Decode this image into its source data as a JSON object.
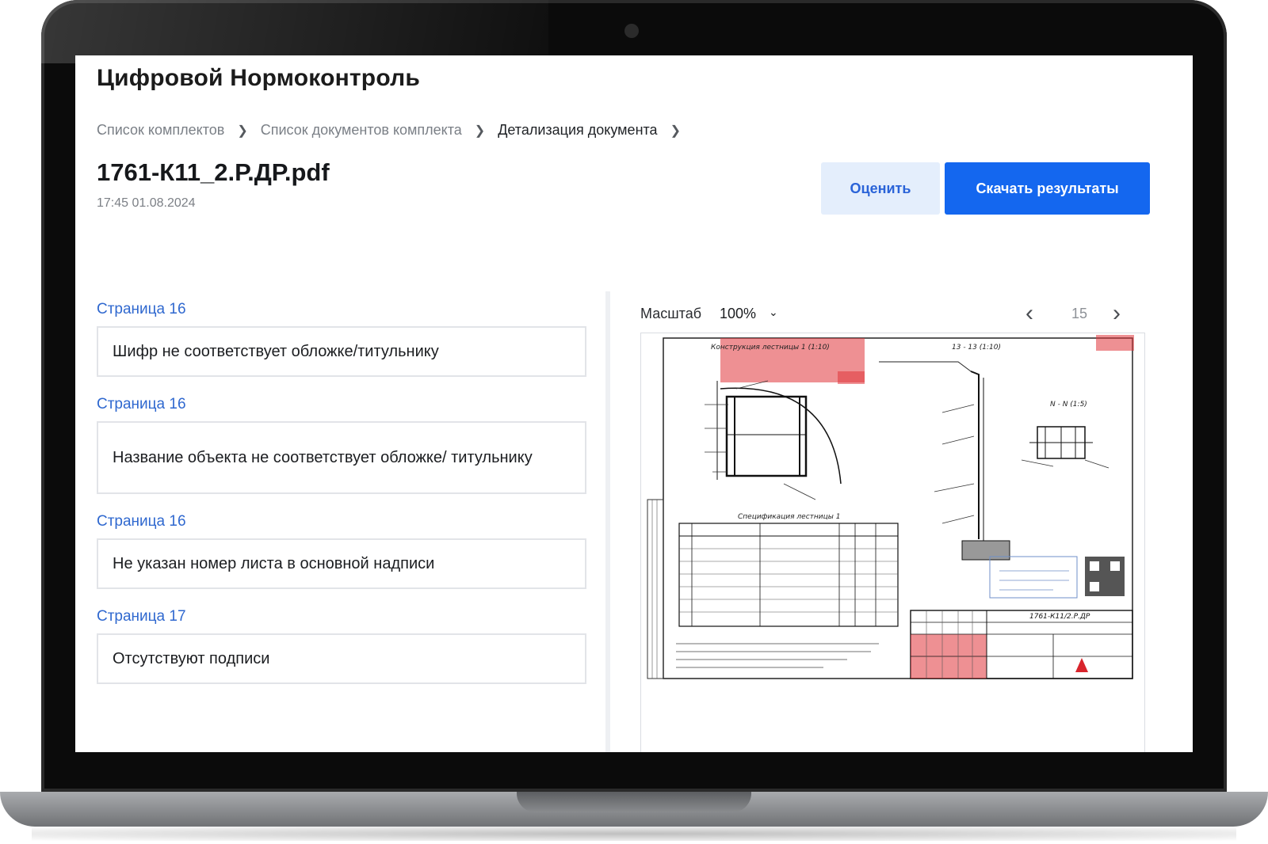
{
  "app": {
    "title": "Цифровой Нормоконтроль"
  },
  "breadcrumb": [
    {
      "label": "Список комплектов"
    },
    {
      "label": "Список документов комплекта"
    },
    {
      "label": "Детализация документа"
    }
  ],
  "document": {
    "title": "1761-К11_2.Р.ДР.pdf",
    "date": "17:45 01.08.2024"
  },
  "actions": {
    "rate_label": "Оценить",
    "download_label": "Скачать результаты"
  },
  "issues": [
    {
      "page": "Страница 16",
      "text": "Шифр не соответствует обложке/титульнику"
    },
    {
      "page": "Страница 16",
      "text": "Название объекта не соответствует обложке/ титульнику"
    },
    {
      "page": "Страница 16",
      "text": "Не указан номер листа в основной надписи"
    },
    {
      "page": "Страница 17",
      "text": "Отсутствуют подписи"
    }
  ],
  "viewer": {
    "scale_label": "Масштаб",
    "scale_value": "100%",
    "page_number": "15",
    "drawing": {
      "title_left": "Конструкция лестницы 1 (1:10)",
      "title_right": "13 - 13 (1:10)",
      "title_detail": "N - N (1:5)",
      "spec_title": "Спецификация лестницы 1",
      "stamp_code": "1761-К11/2.Р.ДР",
      "highlight_color": "#e0343a"
    }
  },
  "colors": {
    "accent": "#1467ef",
    "link": "#2f68cf",
    "secondary_button_bg": "#e4eefc"
  },
  "icons": {
    "breadcrumb_separator": "chevron-right-icon",
    "scale_dropdown": "chevron-down-icon",
    "prev_page": "chevron-left-icon",
    "next_page": "chevron-right-icon"
  }
}
